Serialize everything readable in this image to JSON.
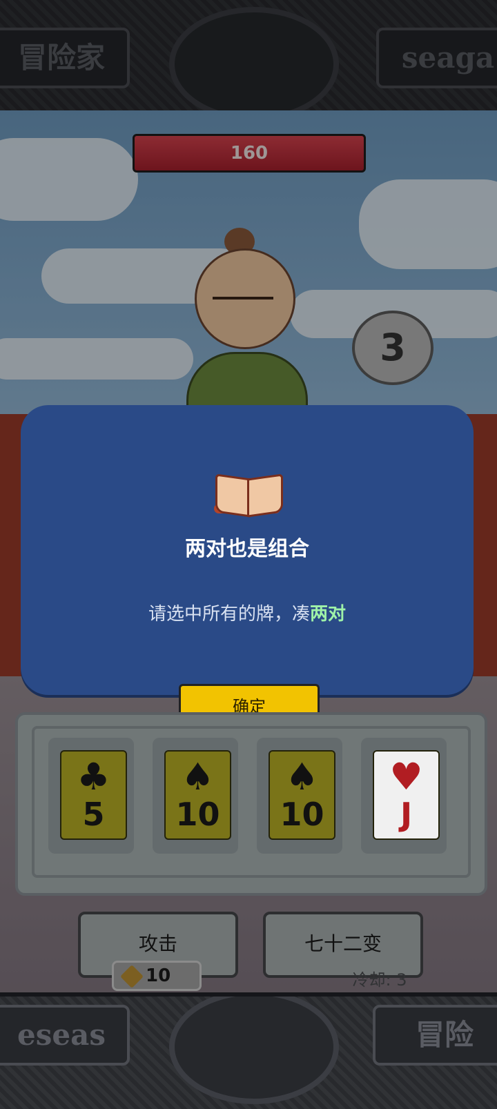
{
  "header": {
    "left_plaque": "冒险家",
    "right_plaque": "seaga"
  },
  "footer": {
    "left_plaque": "eseas",
    "right_plaque": "冒险"
  },
  "enemy": {
    "hp": "160"
  },
  "round_counter": "3",
  "dialog": {
    "title": "两对也是组合",
    "message_prefix": "请选中所有的牌，凑",
    "message_highlight": "两对",
    "confirm_label": "确定"
  },
  "cards": [
    {
      "suit": "♣",
      "rank": "5",
      "style": "dim"
    },
    {
      "suit": "♠",
      "rank": "10",
      "style": "dim"
    },
    {
      "suit": "♠",
      "rank": "10",
      "style": "dim"
    },
    {
      "suit": "♥",
      "rank": "J",
      "style": "white"
    }
  ],
  "actions": {
    "attack_label": "攻击",
    "attack_cost": "10",
    "transform_label": "七十二变",
    "transform_cooldown": "冷却: 3"
  }
}
